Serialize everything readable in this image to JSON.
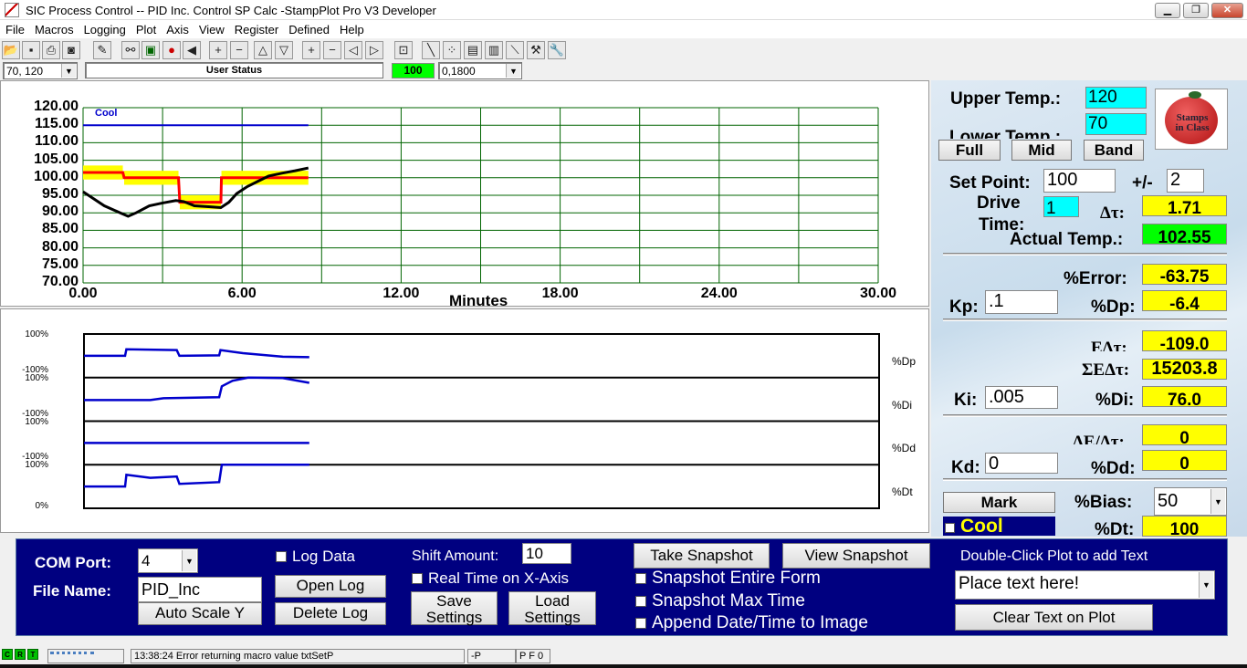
{
  "window": {
    "title": "SIC Process Control -- PID Inc. Control SP Calc -StampPlot Pro V3 Developer",
    "controls": [
      "minimize-icon",
      "restore-icon",
      "close-icon"
    ]
  },
  "menu": [
    "File",
    "Macros",
    "Logging",
    "Plot",
    "Axis",
    "View",
    "Register",
    "Defined",
    "Help"
  ],
  "toolbar": {
    "icons": [
      "open-icon",
      "save-icon",
      "print-icon",
      "camera-icon",
      "wand-icon",
      "connect-icon",
      "monitor-icon",
      "stop-icon",
      "back-arrow-icon",
      "y-plus-icon",
      "y-minus-icon",
      "y-up-icon",
      "y-down-icon",
      "x-plus-icon",
      "x-minus-icon",
      "x-left-icon",
      "x-right-icon",
      "time-icon",
      "pen-icon",
      "points-icon",
      "note-icon",
      "calc-icon",
      "probe-icon",
      "tools-icon",
      "wrench-icon"
    ]
  },
  "statusrow": {
    "y_range": "70, 120",
    "user_status": "User Status",
    "value": "100",
    "x_range": "0,1800"
  },
  "colors": {
    "setpoint": "#ff0000",
    "band": "#ffff00",
    "temperature": "#000000",
    "cool": "#0000cc",
    "grid": "#006400",
    "panel": "#000080",
    "value_box": "#ffff00",
    "actual": "#00ff00",
    "limit_box": "#00ffff"
  },
  "chart_data": [
    {
      "type": "line",
      "xlabel": "Minutes",
      "xlim": [
        0,
        30
      ],
      "ylim": [
        70,
        120
      ],
      "grid": true,
      "yticks": [
        "120.00",
        "115.00",
        "110.00",
        "105.00",
        "100.00",
        "95.00",
        "90.00",
        "85.00",
        "80.00",
        "75.00",
        "70.00"
      ],
      "xticks": [
        "0.00",
        "6.00",
        "12.00",
        "18.00",
        "24.00",
        "30.00"
      ],
      "annotation": "Cool",
      "series": [
        {
          "key": "cool",
          "points": [
            [
              0,
              115
            ],
            [
              8.5,
              115
            ]
          ]
        },
        {
          "key": "setpoint",
          "band": 2,
          "points": [
            [
              0,
              101.5
            ],
            [
              1.5,
              101.5
            ],
            [
              1.55,
              100
            ],
            [
              3.6,
              100
            ],
            [
              3.65,
              93
            ],
            [
              5.2,
              93
            ],
            [
              5.22,
              100
            ],
            [
              8.5,
              100
            ]
          ]
        },
        {
          "key": "temperature",
          "points": [
            [
              0,
              96
            ],
            [
              0.3,
              94.5
            ],
            [
              0.8,
              92
            ],
            [
              1.4,
              90
            ],
            [
              1.7,
              89
            ],
            [
              2.0,
              90
            ],
            [
              2.5,
              92
            ],
            [
              3.0,
              92.8
            ],
            [
              3.5,
              93.5
            ],
            [
              3.8,
              93.2
            ],
            [
              4.2,
              92
            ],
            [
              4.8,
              91.7
            ],
            [
              5.2,
              91.5
            ],
            [
              5.5,
              93
            ],
            [
              5.8,
              95.5
            ],
            [
              6.2,
              97.5
            ],
            [
              6.6,
              99
            ],
            [
              7.0,
              100.5
            ],
            [
              7.5,
              101.3
            ],
            [
              8.0,
              102
            ],
            [
              8.5,
              102.8
            ]
          ]
        }
      ]
    },
    {
      "type": "line",
      "xlim": [
        0,
        30
      ],
      "strips": [
        {
          "name": "%Dp",
          "ylim": [
            -100,
            100
          ],
          "top_label": "100%",
          "bottom_label": "-100%",
          "points": [
            [
              0,
              0
            ],
            [
              1.55,
              0
            ],
            [
              1.6,
              30
            ],
            [
              3.5,
              26
            ],
            [
              3.6,
              0
            ],
            [
              5.1,
              2
            ],
            [
              5.15,
              26
            ],
            [
              6,
              12
            ],
            [
              7.5,
              -4
            ],
            [
              8.5,
              -6.4
            ]
          ]
        },
        {
          "name": "%Di",
          "ylim": [
            -100,
            100
          ],
          "top_label": "100%",
          "bottom_label": "-100%",
          "points": [
            [
              0,
              -3
            ],
            [
              2.5,
              -3
            ],
            [
              3,
              5
            ],
            [
              5.1,
              10
            ],
            [
              5.2,
              60
            ],
            [
              5.6,
              85
            ],
            [
              6.2,
              100
            ],
            [
              7.5,
              98
            ],
            [
              8.5,
              76
            ]
          ]
        },
        {
          "name": "%Dd",
          "ylim": [
            -100,
            100
          ],
          "top_label": "100%",
          "bottom_label": "-100%",
          "points": [
            [
              0,
              0
            ],
            [
              8.5,
              0
            ]
          ]
        },
        {
          "name": "%Dt",
          "ylim": [
            0,
            100
          ],
          "top_label": "100%",
          "bottom_label": "0%",
          "points": [
            [
              0,
              50
            ],
            [
              1.55,
              50
            ],
            [
              1.6,
              77
            ],
            [
              2.5,
              70
            ],
            [
              3.5,
              73
            ],
            [
              3.6,
              56
            ],
            [
              5.1,
              60
            ],
            [
              5.2,
              100
            ],
            [
              8.5,
              100
            ]
          ]
        }
      ]
    }
  ],
  "right": {
    "upper_label": "Upper Temp.:",
    "upper": "120",
    "lower_label": "Lower Temp.:",
    "lower": "70",
    "logo": "Stamps in Class",
    "full": "Full",
    "mid": "Mid",
    "band": "Band",
    "setpoint_label": "Set Point:",
    "setpoint": "100",
    "pm_label": "+/-",
    "pm": "2",
    "drive_label": "Drive",
    "time_label": "Time:",
    "drive": "1",
    "dt_label": "Δτ:",
    "dt": "1.71",
    "actual_label": "Actual Temp.:",
    "actual": "102.55",
    "error_label": "%Error:",
    "error": "-63.75",
    "kp_label": "Kp:",
    "kp": ".1",
    "dp_label": "%Dp:",
    "dp": "-6.4",
    "edt_label": "EΔτ:",
    "edt": "-109.0",
    "sum_label": "ΣEΔτ:",
    "sum": "15203.8",
    "ki_label": "Ki:",
    "ki": ".005",
    "di_label": "%Di:",
    "di": "76.0",
    "dedt_label": "ΔE/Δτ:",
    "dedt": "0",
    "kd_label": "Kd:",
    "kd": "0",
    "dd_label": "%Dd:",
    "dd": "0",
    "mark": "Mark",
    "bias_label": "%Bias:",
    "bias": "50",
    "cool": "Cool",
    "dtp_label": "%Dt:",
    "dtp": "100"
  },
  "bottom": {
    "com_label": "COM Port:",
    "com": "4",
    "file_label": "File Name:",
    "file": "PID_Inc",
    "autoscale": "Auto Scale Y",
    "logdata": "Log Data",
    "openlog": "Open Log",
    "deletelog": "Delete Log",
    "shift_label": "Shift Amount:",
    "shift": "10",
    "realtime": "Real Time on X-Axis",
    "save": "Save Settings",
    "load": "Load Settings",
    "take": "Take Snapshot",
    "view": "View Snapshot",
    "entire": "Snapshot Entire Form",
    "maxtime": "Snapshot Max Time",
    "append": "Append Date/Time to Image",
    "dbl_label": "Double-Click Plot to add Text",
    "text": "Place text here!",
    "clear": "Clear Text on Plot"
  },
  "status": {
    "c": "C",
    "r": "R",
    "t": "T",
    "message": "13:38:24 Error returning macro value txtSetP",
    "p": "-P",
    "pf": "P F 0"
  }
}
